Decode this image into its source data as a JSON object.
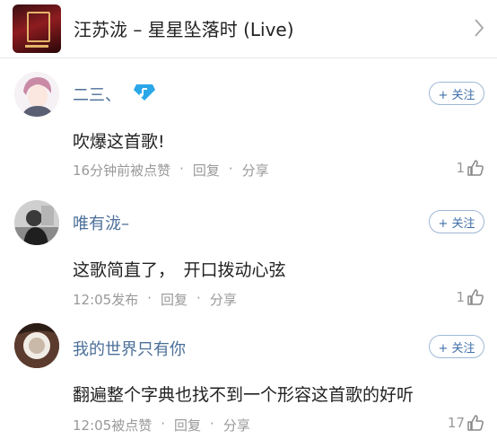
{
  "header": {
    "song_title": "汪苏泷 – 星星坠落时 (Live)",
    "icons": {
      "album": "album-cover",
      "chevron": "chevron-right-icon"
    }
  },
  "comments": [
    {
      "username": "二三、",
      "has_badge": true,
      "follow_label": "+ 关注",
      "text": "吹爆这首歌!",
      "meta": [
        "16分钟前被点赞",
        "回复",
        "分享"
      ],
      "likes": "1"
    },
    {
      "username": "唯有泷–",
      "has_badge": false,
      "follow_label": "+ 关注",
      "text": "这歌简直了，　开口拨动心弦",
      "meta": [
        "12:05发布",
        "回复",
        "分享"
      ],
      "likes": "1"
    },
    {
      "username": "我的世界只有你",
      "has_badge": false,
      "follow_label": "+ 关注",
      "text": "翻遍整个字典也找不到一个形容这首歌的好听",
      "meta": [
        "12:05被点赞",
        "回复",
        "分享"
      ],
      "likes": "17"
    }
  ],
  "colors": {
    "username": "#4b6f99",
    "follow": "#3f6fa8",
    "badge": "#2aa7e8",
    "meta": "#999999"
  }
}
